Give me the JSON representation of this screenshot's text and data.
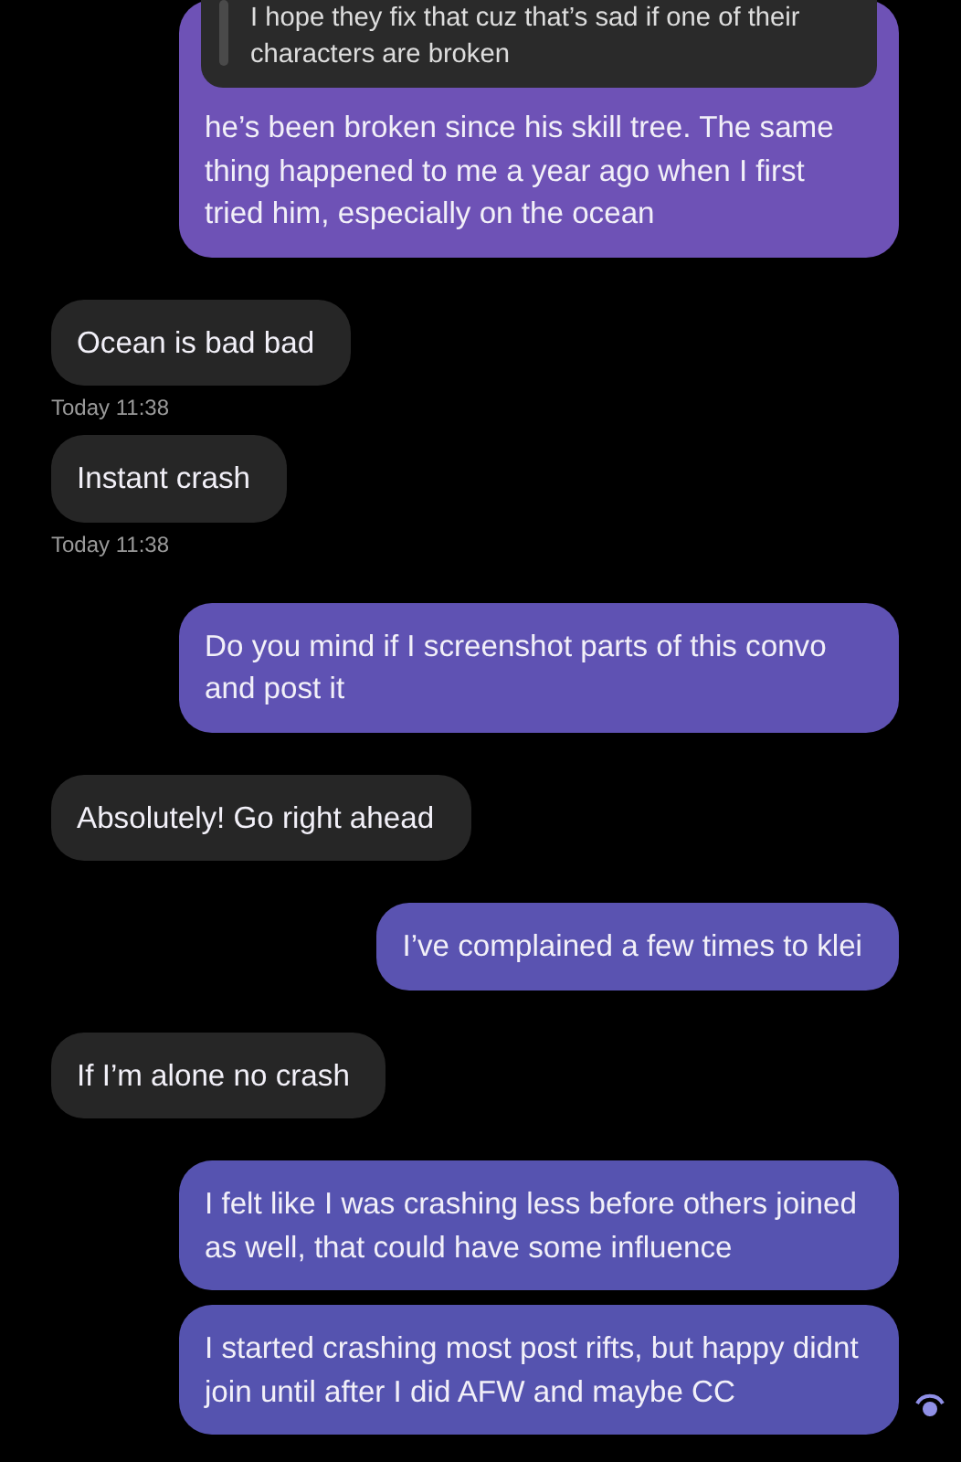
{
  "messages": [
    {
      "kind": "sent",
      "color": "#6e52b6",
      "quote": "I hope they fix that cuz that’s sad if one of their characters are broken",
      "text": "he’s been broken since his skill tree. The same thing happened to me a year ago when I first tried him, especially on the ocean"
    },
    {
      "kind": "received",
      "text": "Ocean is bad bad",
      "time": "Today 11:38"
    },
    {
      "kind": "received",
      "text": "Instant crash",
      "time": "Today 11:38"
    },
    {
      "kind": "sent",
      "color": "#5f52b3",
      "text": "Do you mind if I screenshot parts of this convo and post it"
    },
    {
      "kind": "received",
      "text": "Absolutely! Go right ahead"
    },
    {
      "kind": "sent",
      "color": "#5a53b1",
      "text": "I’ve complained a few times to klei"
    },
    {
      "kind": "received",
      "text": "If I’m alone no crash"
    },
    {
      "kind": "sent",
      "color": "#5653b0",
      "text": "I felt like I was crashing less before others joined as well, that could have some influence"
    },
    {
      "kind": "sent",
      "color": "#5553af",
      "text": "I started crashing most post rifts, but happy didnt join until after I did AFW and maybe CC",
      "seen": true
    }
  ]
}
